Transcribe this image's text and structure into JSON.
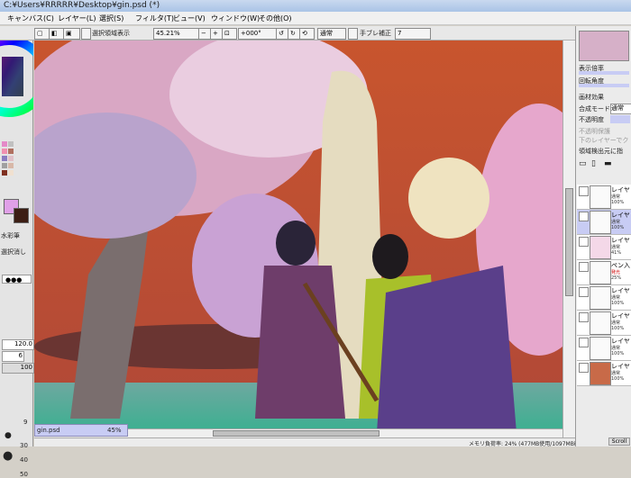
{
  "window": {
    "title": "C:¥Users¥RRRRR¥Desktop¥gin.psd (*)"
  },
  "menu": [
    "キャンバス(C)",
    "レイヤー(L)",
    "選択(S)",
    "フィルタ(T)",
    "ビュー(V)",
    "ウィンドウ(W)",
    "その他(O)"
  ],
  "toolbar": {
    "select_source_label": "選択領域表示",
    "zoom": "45.21%",
    "rotation": "+000°",
    "blend_mode": "通常",
    "stabilizer_label": "手ブレ補正",
    "stabilizer_value": "7"
  },
  "left_panel": {
    "tool_watercolor": "水彩筆",
    "tool_selection": "選択消し",
    "brush_size": "120.0",
    "density": "6",
    "percent_100": "100",
    "brush_sizes": [
      "9",
      "30",
      "40",
      "50"
    ]
  },
  "right_panel": {
    "display_zoom_label": "表示倍率",
    "rotation_label": "回転角度",
    "material_effect": "画材効果",
    "blend_mode_label": "合成モード",
    "blend_mode_value": "通常",
    "opacity_label": "不透明度",
    "protect_opacity": "不透明保護",
    "clip_lower": "下のレイヤーでク",
    "selection_source": "領域検出元に指",
    "layers": [
      {
        "name": "レイヤ",
        "mode": "通常",
        "opacity": "100%"
      },
      {
        "name": "レイヤ",
        "mode": "通常",
        "opacity": "100%"
      },
      {
        "name": "レイヤ",
        "mode": "通常",
        "opacity": "41%"
      },
      {
        "name": "ペン入",
        "mode": "発光",
        "opacity": "25%"
      },
      {
        "name": "レイヤ",
        "mode": "通常",
        "opacity": "100%"
      },
      {
        "name": "レイヤ",
        "mode": "通常",
        "opacity": "100%"
      },
      {
        "name": "レイヤ",
        "mode": "通常",
        "opacity": "100%"
      },
      {
        "name": "レイヤ",
        "mode": "通常",
        "opacity": "100%"
      }
    ]
  },
  "document_tab": {
    "name": "gin.psd",
    "zoom": "45%"
  },
  "status": {
    "memory": "メモリ負荷率: 24% (477MB使用/1097MB確保)",
    "scroll_label": "Scroll"
  },
  "colors": {
    "accent": "#c8ccf4",
    "selected_color": "#e0a0e8",
    "bg_color": "#3c1e14"
  }
}
